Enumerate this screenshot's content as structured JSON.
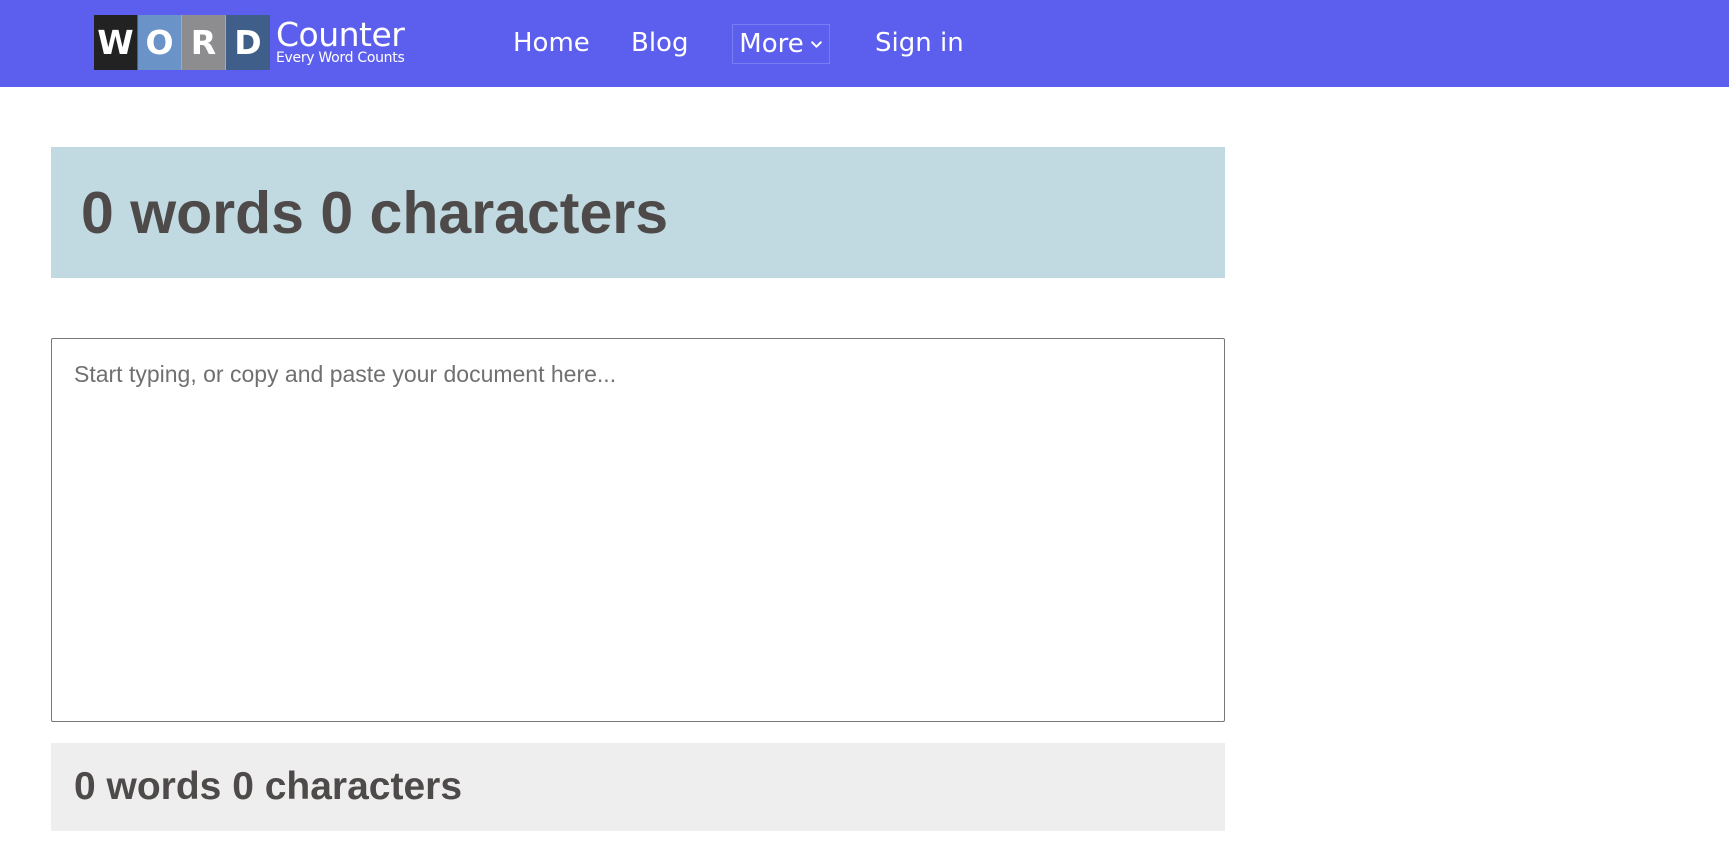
{
  "brand": {
    "tiles": [
      "W",
      "O",
      "R",
      "D"
    ],
    "title": "Counter",
    "tagline": "Every Word Counts"
  },
  "nav": {
    "home": "Home",
    "blog": "Blog",
    "more": "More",
    "signin": "Sign in"
  },
  "counts": {
    "header_summary": "0 words 0 characters",
    "footer_summary": "0 words 0 characters"
  },
  "editor": {
    "value": "",
    "placeholder": "Start typing, or copy and paste your document here..."
  },
  "colors": {
    "navbar": "#5c5fee",
    "banner": "#c1d9e0",
    "footer": "#eeeeee",
    "count_text": "#4f4a4a"
  },
  "icons": {
    "more_dropdown": "chevron-down-icon"
  }
}
